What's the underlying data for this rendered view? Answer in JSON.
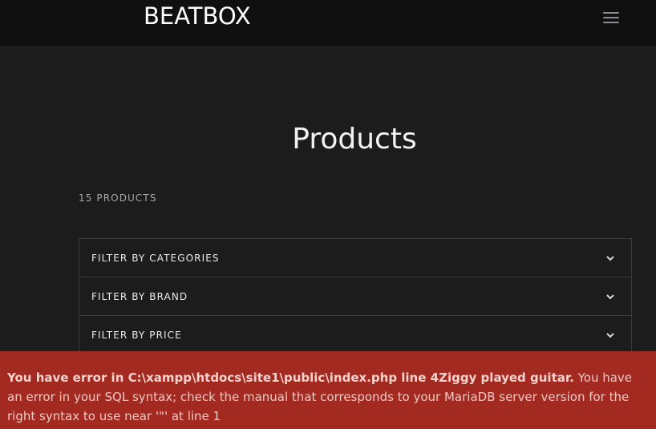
{
  "header": {
    "brand": "BEATBOX",
    "menu_icon": "hamburger-icon"
  },
  "main": {
    "title": "Products",
    "product_count": "15 PRODUCTS",
    "filters": [
      {
        "label": "FILTER BY CATEGORIES",
        "icon": "chevron-down-icon"
      },
      {
        "label": "FILTER BY BRAND",
        "icon": "chevron-down-icon"
      },
      {
        "label": "FILTER BY PRICE",
        "icon": "chevron-down-icon"
      }
    ]
  },
  "error": {
    "heading": "You have error in C:\\xampp\\htdocs\\site1\\public\\index.php line 4Ziggy played guitar.",
    "message": " You have an error in your SQL syntax; check the manual that corresponds to your MariaDB server version for the right syntax to use near '\"' at line 1"
  },
  "colors": {
    "background": "#1c1c1d",
    "header": "#101011",
    "error": "#a32a20"
  }
}
